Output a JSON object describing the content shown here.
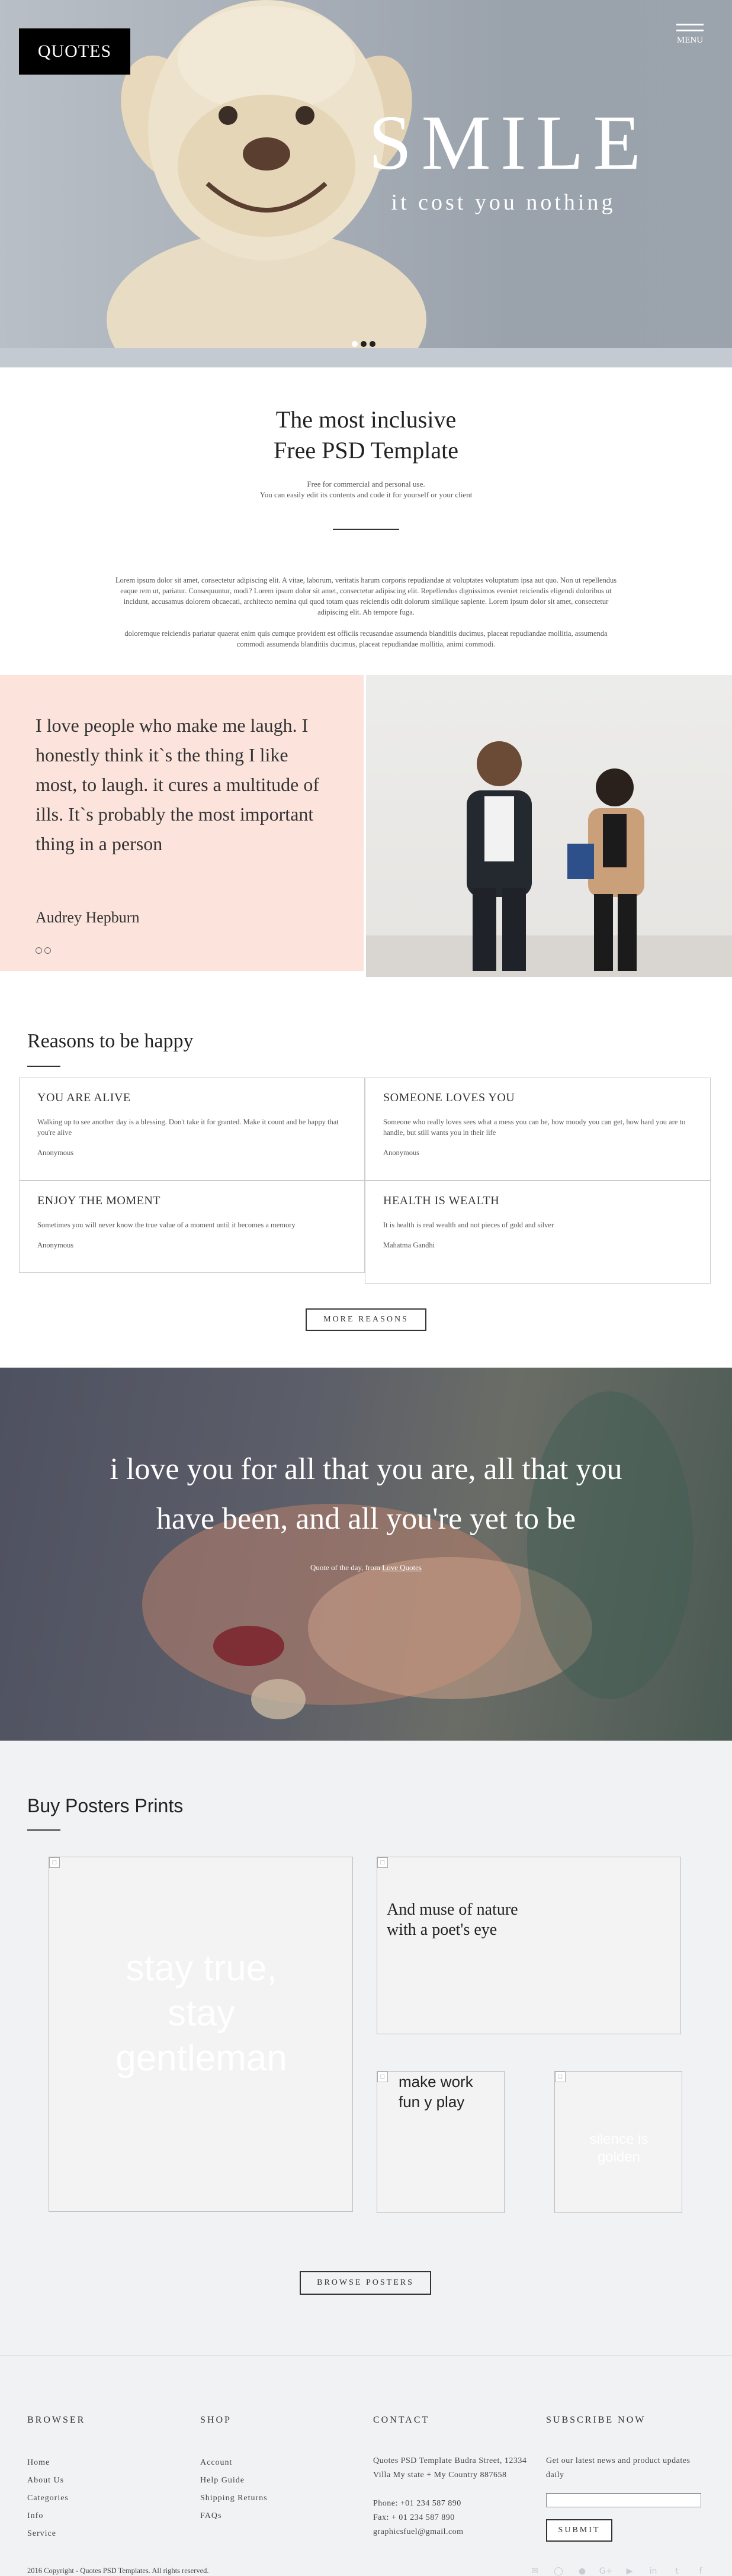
{
  "hero": {
    "logo": "QUOTES",
    "menu_label": "MENU",
    "title": "SMILE",
    "subtitle": "it cost you nothing",
    "slides": 3,
    "active_slide": 2
  },
  "intro": {
    "heading_line1": "The most inclusive",
    "heading_line2": "Free PSD Template",
    "small_line1": "Free for commercial and personal use.",
    "small_line2": "You can easily edit its contents and code it for yourself or your client",
    "para1": "Lorem ipsum dolor sit amet, consectetur adipiscing elit. A vitae, laborum, veritatis harum corporis repudiandae at voluptates voluptatum ipsa aut quo. Non ut repellendus eaque rem ut, pariatur. Consequuntur, modi? Lorem ipsum dolor sit amet, consectetur adipiscing elit. Repellendus dignissimos eveniet reiciendis eligendi doloribus ut incidunt, accusamus dolorem obcaecati, architecto nemina qui quod totam quas reiciendis odit dolorum similique sapiente. Lorem ipsum dolor sit amet, consectetur adipiscing elit. Ab tempore fuga.",
    "para2": "doloremque reiciendis pariatur quaerat enim quis cumque provident est officiis recusandae assumenda blanditiis ducimus, placeat repudiandae mollitia, assumenda commodi assumenda blanditiis ducimus, placeat repudiandae mollitia, animi commodi."
  },
  "quote": {
    "text": "I love people who make me laugh. I honestly think it`s the thing I like most, to laugh. it cures a multitude of ills. It`s probably the most important thing in a person",
    "author": "Audrey Hepburn"
  },
  "reasons": {
    "title": "Reasons to be happy",
    "cards": [
      {
        "title": "YOU ARE ALIVE",
        "text": "Walking up to see another day is a blessing. Don't take it for granted. Make it count and be happy that you're alive",
        "by": "Anonymous"
      },
      {
        "title": "SOMEONE LOVES YOU",
        "text": "Someone who really loves sees what a mess you can be, how moody you can get, how hard you are to handle, but still wants you in their life",
        "by": "Anonymous"
      },
      {
        "title": "ENJOY THE MOMENT",
        "text": "Sometimes you will never know the true value of a moment until it becomes a memory",
        "by": "Anonymous"
      },
      {
        "title": "HEALTH IS WEALTH",
        "text": "It is health is real wealth and not pieces of gold and silver",
        "by": "Mahatma Gandhi"
      }
    ],
    "more_button": "MORE REASONS"
  },
  "love": {
    "line1": "i love you for all that you are, all that you",
    "line2": "have been, and all you're yet to be",
    "credit_prefix": "Quote of the day, from",
    "credit_link": "Love Quotes"
  },
  "posters": {
    "title": "Buy Posters Prints",
    "items": [
      {
        "text": "stay true, stay gentleman"
      },
      {
        "text": "And muse of nature with a poet's eye"
      },
      {
        "text": "make work fun y play"
      },
      {
        "text": "silence is golden"
      }
    ],
    "browse_button": "BROWSE POSTERS"
  },
  "footer": {
    "browser": {
      "title": "BROWSER",
      "links": [
        "Home",
        "About Us",
        "Categories",
        "Info",
        "Service"
      ]
    },
    "shop": {
      "title": "SHOP",
      "links": [
        "Account",
        "Help Guide",
        "Shipping Returns",
        "FAQs"
      ]
    },
    "contact": {
      "title": "CONTACT",
      "address": "Quotes PSD Template Budra Street, 12334 Villa My state + My Country 887658",
      "phone": "Phone: +01 234 587 890",
      "fax": "Fax: + 01 234 587 890",
      "email": "graphicsfuel@gmail.com"
    },
    "subscribe": {
      "title": "SUBSCRIBE NOW",
      "text": "Get our latest news and product updates daily",
      "button": "SUBMIT"
    },
    "copyright": "2016 Copyright - Quotes PSD Templates. All rights reserved.",
    "social": [
      "mail-icon",
      "instagram-icon",
      "pinterest-icon",
      "google-plus-icon",
      "youtube-icon",
      "linkedin-icon",
      "twitter-icon",
      "facebook-icon"
    ]
  }
}
